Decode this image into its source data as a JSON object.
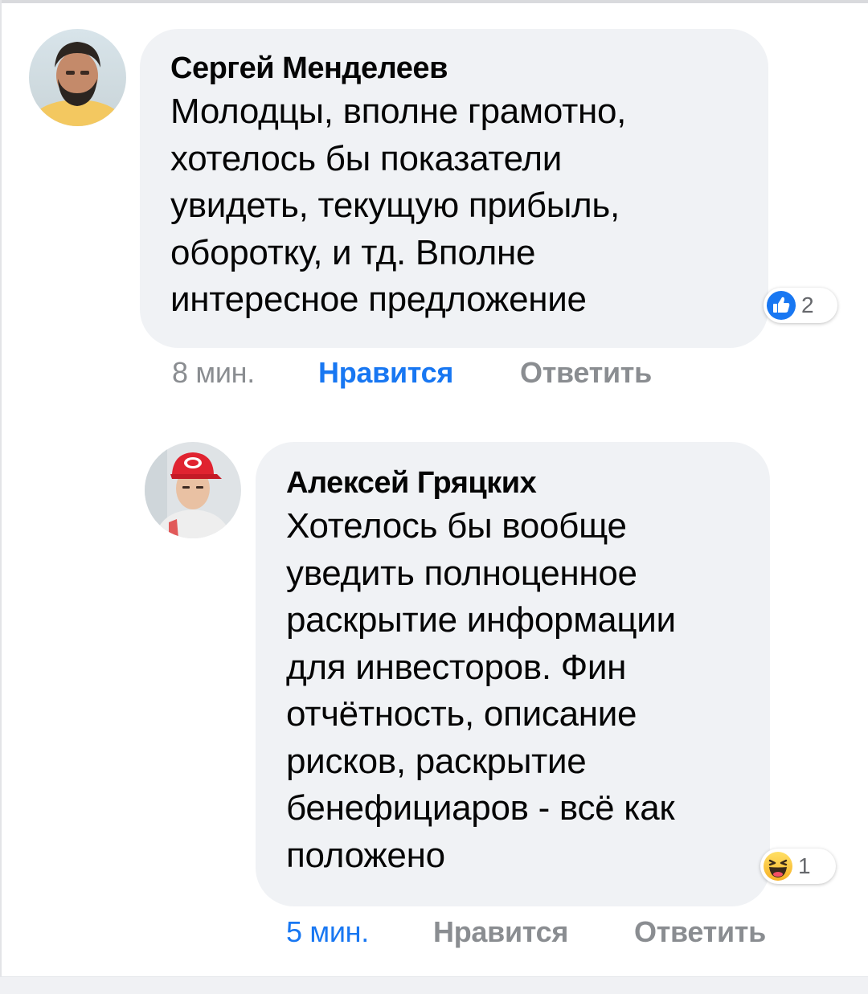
{
  "comments": [
    {
      "author": "Сергей Менделеев",
      "text": "Молодцы, вполне грамотно,\nхотелось бы показатели\nувидеть, текущую прибыль,\nоборотку, и тд. Вполне\nинтересное предложение",
      "reaction": {
        "icon": "like-icon",
        "count": "2"
      },
      "time": "8 мин.",
      "like_label": "Нравится",
      "reply_label": "Ответить",
      "liked_by_viewer": true
    },
    {
      "author": "Алексей Гряцких",
      "text": "Хотелось бы вообще\nуведить полноценное\nраскрытие информации\nдля инвесторов. Фин\nотчётность, описание\nрисков, раскрытие\nбенефициаров - всё как\nположено",
      "reaction": {
        "icon": "haha-icon",
        "count": "1"
      },
      "time": "5 мин.",
      "like_label": "Нравится",
      "reply_label": "Ответить",
      "liked_by_viewer": false
    }
  ],
  "colors": {
    "bubble_bg": "#f0f2f5",
    "link_blue": "#1877f2",
    "muted_text": "#8a8d91",
    "text": "#050505"
  }
}
